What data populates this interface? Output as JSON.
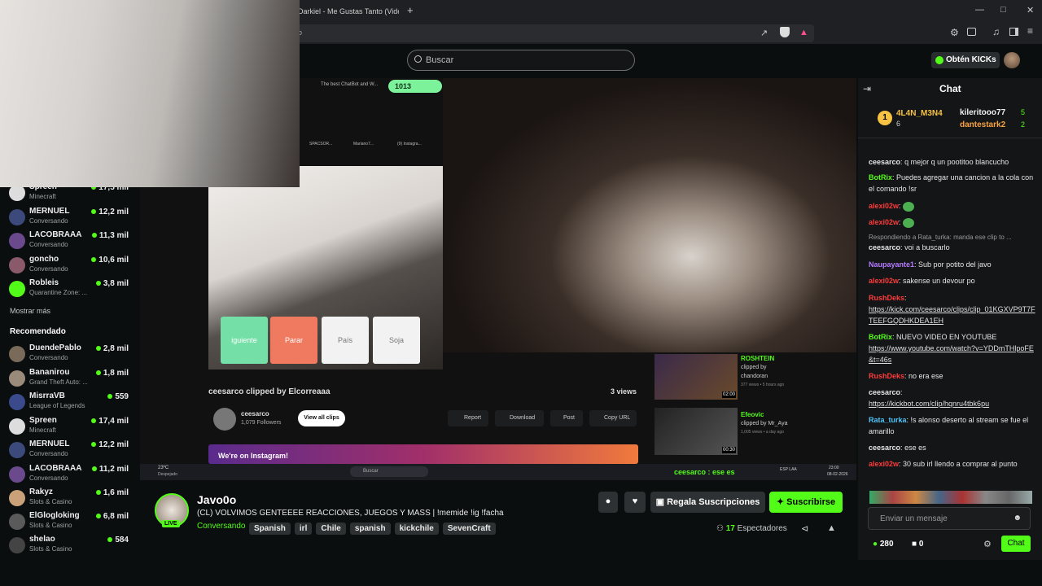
{
  "browser": {
    "tab_title": "Darkiel - Me Gustas Tanto (Video",
    "new_tab": "+",
    "url": "o"
  },
  "header": {
    "search_placeholder": "Buscar",
    "kicks_button": "Obtén KICKs"
  },
  "sidebar": {
    "following": [
      {
        "name": "Spreen",
        "sub": "Minecraft",
        "viewers": "17,5 mil"
      },
      {
        "name": "MERNUEL",
        "sub": "Conversando",
        "viewers": "12,2 mil"
      },
      {
        "name": "LACOBRAAA",
        "sub": "Conversando",
        "viewers": "11,3 mil"
      },
      {
        "name": "goncho",
        "sub": "Conversando",
        "viewers": "10,6 mil"
      },
      {
        "name": "Robleis",
        "sub": "Quarantine Zone: ...",
        "viewers": "3,8 mil"
      }
    ],
    "show_more": "Mostrar más",
    "recommended_title": "Recomendado",
    "recommended": [
      {
        "name": "DuendePablo",
        "sub": "Conversando",
        "viewers": "2,8 mil"
      },
      {
        "name": "Bananirou",
        "sub": "Grand Theft Auto: ...",
        "viewers": "1,8 mil"
      },
      {
        "name": "MisrraVB",
        "sub": "League of Legends",
        "viewers": "559"
      },
      {
        "name": "Spreen",
        "sub": "Minecraft",
        "viewers": "17,4 mil"
      },
      {
        "name": "MERNUEL",
        "sub": "Conversando",
        "viewers": "12,2 mil"
      },
      {
        "name": "LACOBRAAA",
        "sub": "Conversando",
        "viewers": "11,2 mil"
      },
      {
        "name": "Rakyz",
        "sub": "Slots & Casino",
        "viewers": "1,6 mil"
      },
      {
        "name": "ElGlogloking",
        "sub": "Slots & Casino",
        "viewers": "6,8 mil"
      },
      {
        "name": "shelao",
        "sub": "Slots & Casino",
        "viewers": "584"
      }
    ]
  },
  "player": {
    "inner_tab": "The best ChatBot and W...",
    "counter": "1013",
    "inner_tabs": [
      "SPACSOR...",
      "Mariano7...",
      "(9) Instagra..."
    ],
    "game_buttons": [
      "iguiente",
      "Parar",
      "País",
      "Soja"
    ],
    "clip_title": "ceesarco clipped by Elcorreaaa",
    "clip_views": "3 views",
    "channel": "ceesarco",
    "followers": "1,079 Followers",
    "view_all": "View all clips",
    "actions": [
      "Report",
      "Download",
      "Post",
      "Copy URL"
    ],
    "instagram": "We're on Instagram!",
    "side_clips": [
      {
        "title": "ROSHTEIN",
        "by": "clipped by",
        "author": "chandoran",
        "meta": "377 views • 5 hours ago",
        "time": "02:00"
      },
      {
        "title": "Efeovic",
        "by": "clipped by Mr_Aya",
        "author": "",
        "meta": "1,005 views • a day ago",
        "time": "00:30"
      }
    ],
    "taskbar_temp": "23ºC",
    "taskbar_weather": "Despejado",
    "taskbar_search": "Buscar",
    "taskbar_ticker": "ceesarco : ese es",
    "taskbar_lang": "ESP LAA",
    "taskbar_time": "23:00",
    "taskbar_date": "08-02-2026"
  },
  "stream": {
    "streamer": "Javo0o",
    "live": "LIVE",
    "title": "(CL) VOLVIMOS GENTEEEE REACCIONES, JUEGOS Y MASS | !memide !ig !facha",
    "category": "Conversando",
    "tags": [
      "Spanish",
      "irl",
      "Chile",
      "spanish",
      "kickchile",
      "SevenCraft"
    ],
    "gift_button": "Regala Suscripciones",
    "subscribe_button": "Suscribirse",
    "viewers": "17",
    "viewers_label": "Espectadores"
  },
  "chat": {
    "title": "Chat",
    "leaderboard": [
      {
        "rank": "1",
        "name": "4L4N_M3N4",
        "count": "6"
      },
      {
        "name": "kileritooo77",
        "count": "5"
      },
      {
        "name": "dantestark2",
        "count": "2"
      }
    ],
    "messages": [
      {
        "user": "ceesarco",
        "text": "q mejor q un pootitoo blancucho",
        "color": "#ffffff"
      },
      {
        "user": "BotRix",
        "text": "Puedes agregar una cancion a la cola con el comando !sr",
        "color": "#53fc18"
      },
      {
        "user": "alexi02w",
        "text": "",
        "color": "#ff3b3b"
      },
      {
        "user": "alexi02w",
        "text": "",
        "color": "#ff3b3b"
      },
      {
        "reply": "Respondiendo a Rata_turka: manda ese clip to ..."
      },
      {
        "user": "ceesarco",
        "text": "voi a buscarlo",
        "color": "#ffffff"
      },
      {
        "user": "Naupayante1",
        "text": "Sub por potito del javo",
        "color": "#b57bff"
      },
      {
        "user": "alexi02w",
        "text": "sakense un devour po",
        "color": "#ff3b3b"
      },
      {
        "user": "RushDeks",
        "text": "",
        "color": "#ff3b3b"
      },
      {
        "link": "https://kick.com/ceesarco/clips/clip_01KGXVP9T7FTEEFGQDHKDEA1EH"
      },
      {
        "user": "BotRix",
        "text": "NUEVO VIDEO EN YOUTUBE",
        "color": "#53fc18"
      },
      {
        "link": "https://www.youtube.com/watch?v=YDDmTHlpoFE&t=46s"
      },
      {
        "user": "RushDeks",
        "text": "no era ese",
        "color": "#ff3b3b"
      },
      {
        "user": "ceesarco",
        "text": "",
        "color": "#ffffff"
      },
      {
        "link": "https://kickbot.com/clip/hqnru4tbk6pu"
      },
      {
        "user": "Rata_turka",
        "text": "!s alonso deserto al stream se fue el amarillo",
        "color": "#4fc3f7"
      },
      {
        "user": "ceesarco",
        "text": "ese es",
        "color": "#ffffff"
      },
      {
        "user": "alexi02w",
        "text": "30 sub irl llendo a comprar al punto",
        "color": "#ff3b3b"
      }
    ],
    "input_placeholder": "Enviar un mensaje",
    "points": "280",
    "kicks": "0",
    "send_button": "Chat"
  }
}
